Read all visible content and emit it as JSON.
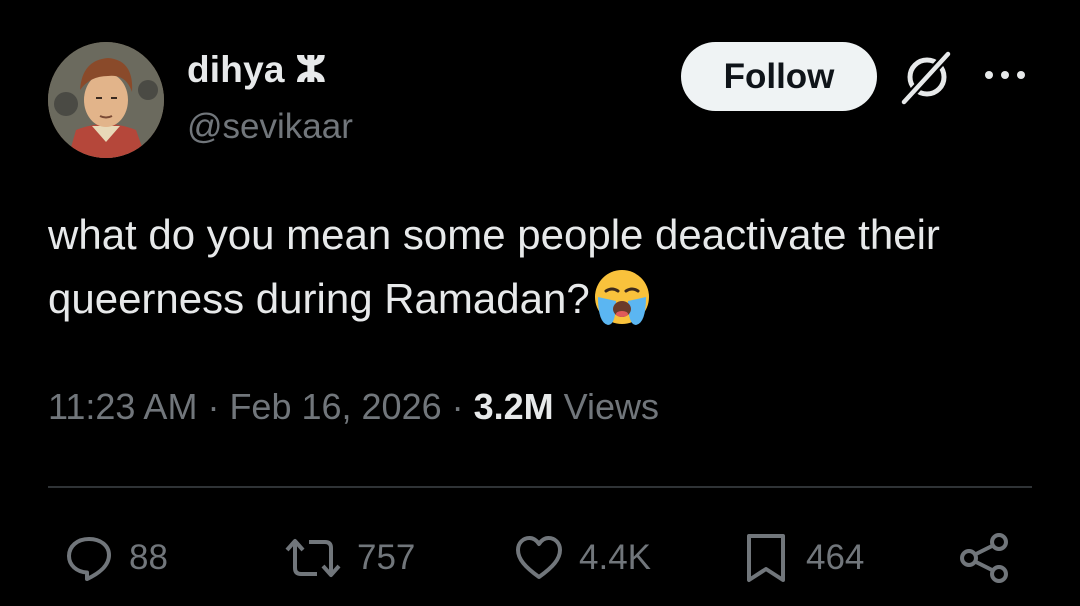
{
  "author": {
    "display_name": "dihya ⵣ",
    "handle": "@sevikaar"
  },
  "header": {
    "follow_label": "Follow"
  },
  "tweet": {
    "text": "what do you mean some people deactivate their queerness during Ramadan?",
    "emoji": "loudly-crying-face"
  },
  "meta": {
    "time": "11:23 AM",
    "sep1": " · ",
    "date": "Feb 16, 2026",
    "sep2": " · ",
    "views_count": "3.2M",
    "views_label": " Views"
  },
  "actions": {
    "replies": "88",
    "reposts": "757",
    "likes": "4.4K",
    "bookmarks": "464"
  },
  "colors": {
    "background": "#000000",
    "text": "#e7e9ea",
    "secondary": "#71767b",
    "follow_bg": "#eff3f4",
    "divider": "#2f3336"
  }
}
